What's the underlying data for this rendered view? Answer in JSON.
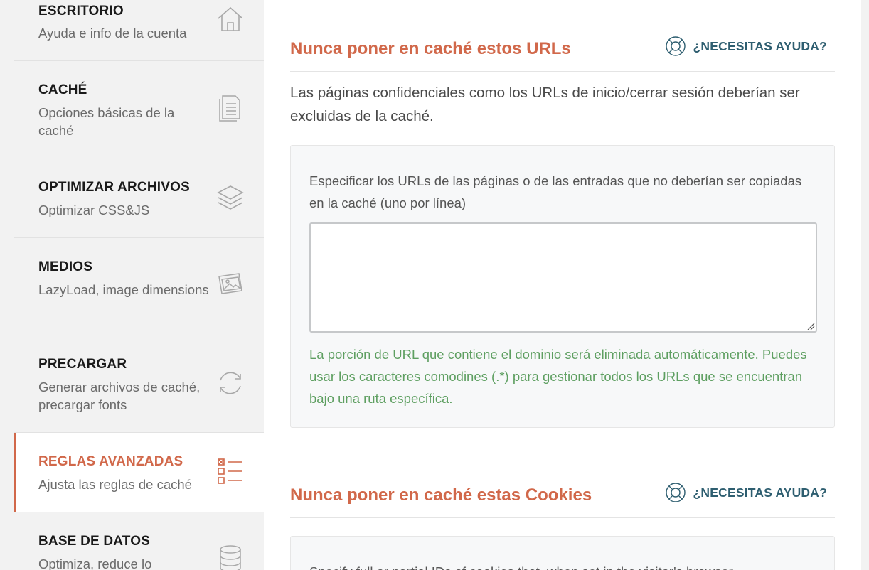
{
  "sidebar": {
    "items": [
      {
        "title": "ESCRITORIO",
        "desc": "Ayuda e info de la cuenta",
        "icon": "home-icon"
      },
      {
        "title": "CACHÉ",
        "desc": "Opciones básicas de la caché",
        "icon": "document-icon"
      },
      {
        "title": "OPTIMIZAR ARCHIVOS",
        "desc": "Optimizar CSS&JS",
        "icon": "layers-icon"
      },
      {
        "title": "MEDIOS",
        "desc": "LazyLoad, image dimensions",
        "icon": "images-icon"
      },
      {
        "title": "PRECARGAR",
        "desc": "Generar archivos de caché, precargar fonts",
        "icon": "refresh-icon"
      },
      {
        "title": "REGLAS AVANZADAS",
        "desc": "Ajusta las reglas de caché",
        "icon": "checklist-icon",
        "active": true
      },
      {
        "title": "BASE DE DATOS",
        "desc": "Optimiza, reduce lo",
        "icon": "database-icon"
      }
    ]
  },
  "main": {
    "section1": {
      "title": "Nunca poner en caché estos URLs",
      "help_label": "¿NECESITAS AYUDA?",
      "intro": "Las páginas confidenciales como los URLs de inicio/cerrar sesión deberían ser excluidas de la caché.",
      "field_label": "Especificar los URLs de las páginas o de las entradas que no deberían ser copiadas en la caché (uno por línea)",
      "field_value": "",
      "note": "La porción de URL que contiene el dominio será eliminada automáticamente. Puedes usar los caracteres comodines (.*) para gestionar todos los URLs que se encuentran bajo una ruta específica."
    },
    "section2": {
      "title": "Nunca poner en caché estas Cookies",
      "help_label": "¿NECESITAS AYUDA?",
      "field_label_partial": "Specify full or partial IDs of cookies that, when set in the visitor's browser,"
    }
  },
  "colors": {
    "accent": "#d1684a",
    "help": "#2e5e70",
    "note": "#5e9f61"
  }
}
